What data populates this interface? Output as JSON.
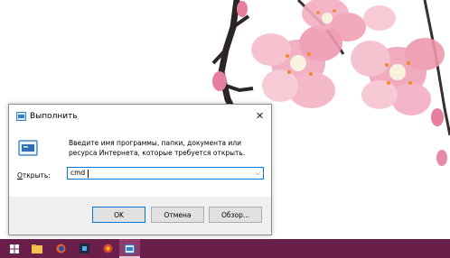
{
  "dialog": {
    "title": "Выполнить",
    "description": "Введите имя программы, папки, документа или ресурса Интернета, которые требуется открыть.",
    "open_label_mnemonic": "О",
    "open_label_rest": "ткрыть:",
    "input_value": "cmd",
    "ok_label": "OK",
    "cancel_label": "Отмена",
    "browse_label": "Обзор..."
  },
  "colors": {
    "taskbar": "#6a1f4a",
    "blossom": "#f0a3b8",
    "accent": "#0078d7"
  },
  "taskbar": {
    "items": [
      "start-icon",
      "file-explorer-icon",
      "firefox-icon",
      "app-icon",
      "chrome-icon",
      "run-icon"
    ]
  }
}
